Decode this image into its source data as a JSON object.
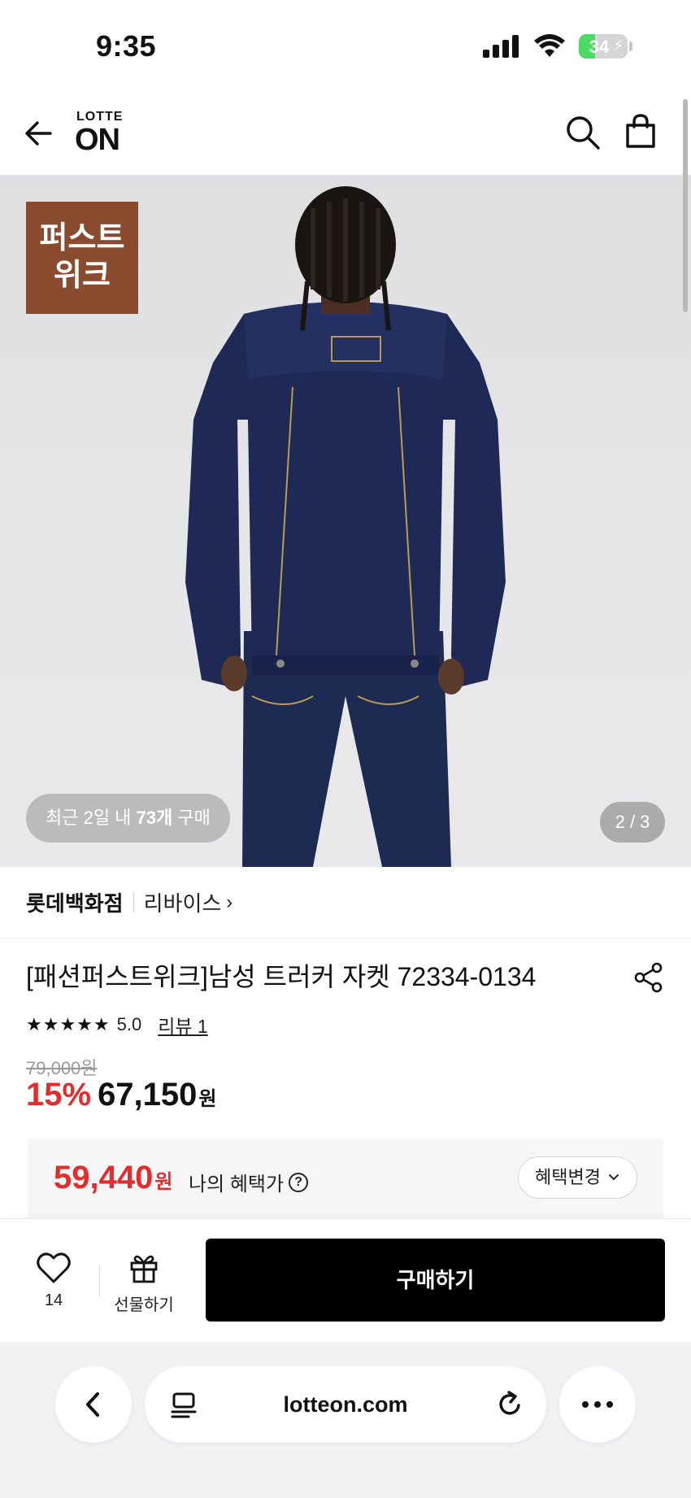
{
  "status_bar": {
    "time": "9:35",
    "battery_level": "34",
    "battery_fraction": 0.34
  },
  "header": {
    "logo_top": "LOTTE",
    "logo_main": "ON",
    "back_icon": "arrow-left-icon",
    "search_icon": "search-icon",
    "cart_icon": "shopping-bag-icon"
  },
  "hero": {
    "badge_text_line1": "퍼스트",
    "badge_text_line2": "위크",
    "recent_prefix": "최근 2일 내 ",
    "recent_count": "73개",
    "recent_suffix": " 구매",
    "page_indicator": "2 / 3",
    "badge_color": "#8a4b2e"
  },
  "seller": {
    "store_name": "롯데백화점",
    "brand_name": "리바이스",
    "brand_chevron": "›"
  },
  "product": {
    "title": "[패션퍼스트위크]남성 트러커 자켓 72334-0134",
    "stars": "★★★★★",
    "rating": "5.0",
    "review_link": "리뷰 1",
    "original_price": "79,000원",
    "discount_rate": "15%",
    "sale_price": "67,150",
    "sale_unit": "원"
  },
  "benefit": {
    "price": "59,440",
    "unit": "원",
    "label": "나의 혜택가",
    "info_icon": "?",
    "change_button": "혜택변경",
    "accent_color": "#e32d2d"
  },
  "actions": {
    "like_count": "14",
    "gift_label": "선물하기",
    "buy_label": "구매하기"
  },
  "browser": {
    "url": "lotteon.com"
  }
}
